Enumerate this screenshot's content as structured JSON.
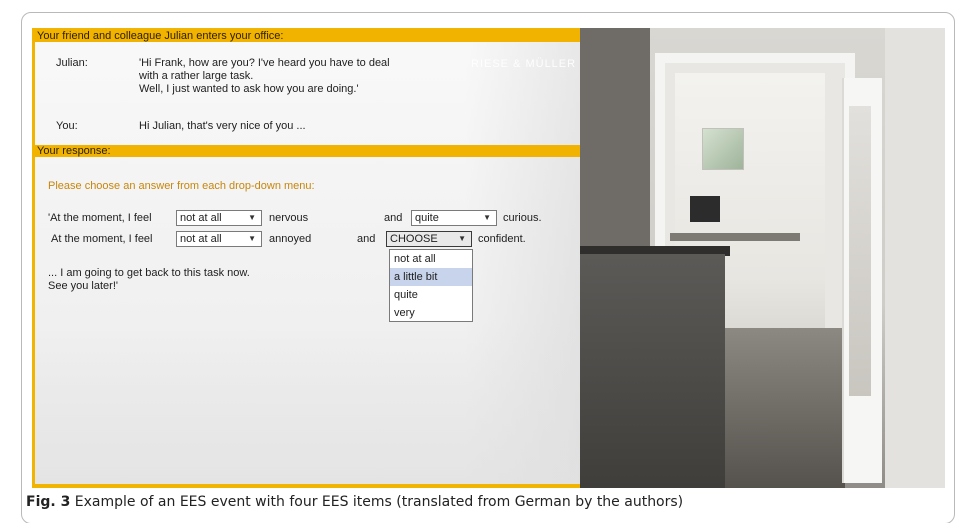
{
  "dialog": {
    "header": "Your friend and colleague Julian enters your office:",
    "julian_label": "Julian:",
    "julian_lines": [
      "'Hi Frank, how are you? I've heard you have to deal",
      "with a rather large task.",
      "Well, I just wanted to ask how you are doing.'"
    ],
    "you_label": "You:",
    "you_line": "Hi Julian, that's very nice of you ..."
  },
  "response": {
    "header": "Your response:",
    "instruction": "Please choose an answer from each drop-down menu:",
    "row1": {
      "prefix": "'At the moment, I feel",
      "select1": "not at all",
      "word1": "nervous",
      "joiner": "and",
      "select2": "quite",
      "word2": "curious."
    },
    "row2": {
      "prefix": "At the moment, I feel",
      "select1": "not at all",
      "word1": "annoyed",
      "joiner": "and",
      "select2": "CHOOSE",
      "word2": "confident."
    },
    "dropdown_options": [
      "not at all",
      "a little bit",
      "quite",
      "very"
    ],
    "highlighted_option": "a little bit",
    "closing_lines": [
      "... I am going to get back to this task now.",
      "See you later!'"
    ]
  },
  "photo": {
    "watermark": "RIESE & MÜLLER"
  },
  "caption": {
    "label": "Fig. 3",
    "text": "Example of an EES event with four EES items (translated from German by the authors)"
  },
  "colors": {
    "accent": "#f2b200",
    "instruction": "#c8870b",
    "highlight": "#c8d4ec"
  }
}
